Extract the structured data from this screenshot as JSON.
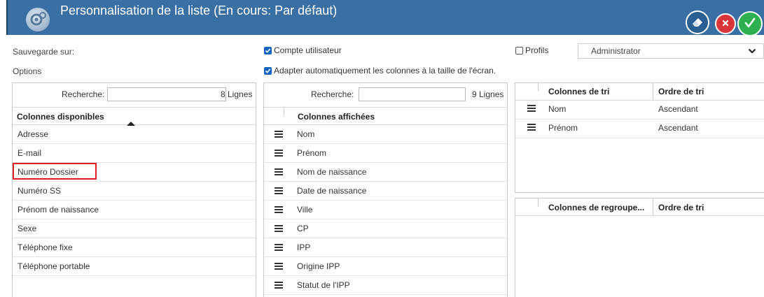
{
  "titlebar": {
    "title": "Personnalisation de la liste (En cours: Par défaut)",
    "icon": "gear-icon",
    "actions": [
      {
        "name": "erase",
        "icon": "eraser-icon"
      },
      {
        "name": "close",
        "icon": "close-icon"
      },
      {
        "name": "validate",
        "icon": "check-icon"
      }
    ]
  },
  "settings": {
    "save_label": "Sauvegarde sur:",
    "options_label": "Options",
    "compte_utilisateur": {
      "label": "Compte utilisateur",
      "checked": true
    },
    "profils": {
      "label": "Profils",
      "checked": false
    },
    "profil_select": "Administrator",
    "adapt_columns": {
      "label": "Adapter automatiquement les colonnes à la taille de l'écran.",
      "checked": true
    }
  },
  "available": {
    "search_label": "Recherche:",
    "search_value": "",
    "count": "8 Lignes",
    "header": "Colonnes disponibles",
    "items": [
      "Adresse",
      "E-mail",
      "Numéro Dossier",
      "Numéro SS",
      "Prénom de naissance",
      "Sexe",
      "Téléphone fixe",
      "Téléphone portable"
    ],
    "highlighted_index": 2
  },
  "displayed": {
    "search_label": "Recherche:",
    "search_value": "",
    "count": "9 Lignes",
    "header": "Colonnes affichées",
    "items": [
      "Nom",
      "Prénom",
      "Nom de naissance",
      "Date de naissance",
      "Ville",
      "CP",
      "IPP",
      "Origine IPP",
      "Statut de l'IPP"
    ]
  },
  "sort": {
    "headers": [
      "Colonnes de tri",
      "Ordre de tri"
    ],
    "rows": [
      {
        "column": "Nom",
        "order": "Ascendant"
      },
      {
        "column": "Prénom",
        "order": "Ascendant"
      }
    ]
  },
  "group": {
    "headers": [
      "Colonnes de regroupe...",
      "Ordre de tri"
    ],
    "rows": []
  },
  "colors": {
    "titlebar": "#3a6fa3",
    "checkbox": "#1565c0",
    "highlight_border": "#e02020",
    "ok": "#2fb050",
    "close": "#d9353b"
  }
}
